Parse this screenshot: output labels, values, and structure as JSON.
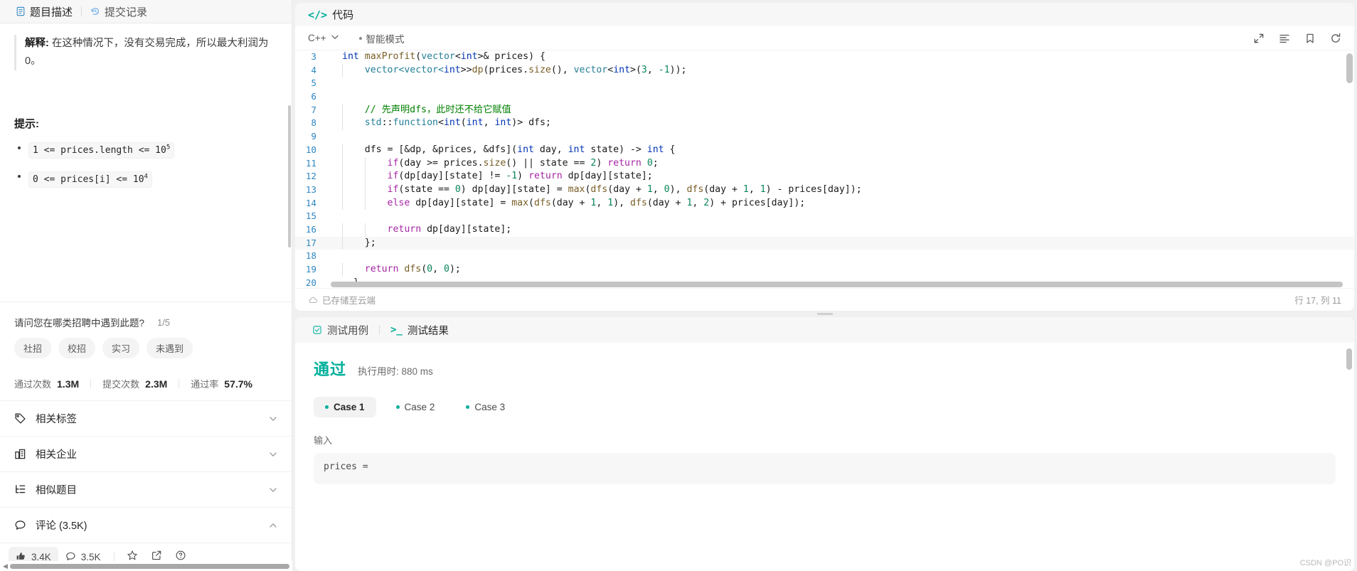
{
  "left": {
    "tabs": [
      {
        "label": "题目描述",
        "icon": "document-icon",
        "active": true
      },
      {
        "label": "提交记录",
        "icon": "history-icon",
        "active": false
      }
    ],
    "description": {
      "explanation_label": "解释:",
      "explanation_text": "在这种情况下，没有交易完成，所以最大利润为 0。"
    },
    "hints_title": "提示:",
    "hints": [
      {
        "expr": "1 <= prices.length <= 10",
        "sup": "5"
      },
      {
        "expr": "0 <= prices[i] <= 10",
        "sup": "4"
      }
    ],
    "poll": {
      "question": "请问您在哪类招聘中遇到此题?",
      "progress": "1/5",
      "options": [
        "社招",
        "校招",
        "实习",
        "未遇到"
      ]
    },
    "stats": [
      {
        "label": "通过次数",
        "value": "1.3M"
      },
      {
        "label": "提交次数",
        "value": "2.3M"
      },
      {
        "label": "通过率",
        "value": "57.7%"
      }
    ],
    "accordions": [
      {
        "label": "相关标签",
        "icon": "tag-icon",
        "expanded": false
      },
      {
        "label": "相关企业",
        "icon": "building-icon",
        "expanded": false
      },
      {
        "label": "相似题目",
        "icon": "list-tree-icon",
        "expanded": false
      },
      {
        "label": "评论 (3.5K)",
        "icon": "comment-icon",
        "expanded": true
      }
    ],
    "footer": {
      "like": {
        "icon": "thumbs-up-icon",
        "count": "3.4K"
      },
      "comment": {
        "icon": "comment-icon",
        "count": "3.5K"
      },
      "star": {
        "icon": "star-icon"
      },
      "share": {
        "icon": "share-external-icon"
      },
      "help": {
        "icon": "question-circle-icon"
      }
    }
  },
  "editor": {
    "panel_title": "代码",
    "panel_icon": "code-brackets-icon",
    "language": "C++",
    "mode": "智能模式",
    "toolbar_icons": [
      "expand-icon",
      "format-icon",
      "bookmark-icon",
      "reset-icon"
    ],
    "status_left": "已存储至云端",
    "status_left_icon": "cloud-icon",
    "status_right": "行 17, 列 11",
    "lines": [
      {
        "n": "3",
        "indent": 0,
        "hl": false,
        "tokens": [
          {
            "t": "int ",
            "c": "t-type"
          },
          {
            "t": "maxProfit",
            "c": "t-fn"
          },
          {
            "t": "(",
            "c": "t-pl"
          },
          {
            "t": "vector",
            "c": "t-ns"
          },
          {
            "t": "<",
            "c": "t-pl"
          },
          {
            "t": "int",
            "c": "t-type"
          },
          {
            "t": ">& prices) {",
            "c": "t-pl"
          }
        ]
      },
      {
        "n": "4",
        "indent": 1,
        "hl": false,
        "tokens": [
          {
            "t": "    vector<vector<",
            "c": "t-ns"
          },
          {
            "t": "int",
            "c": "t-type"
          },
          {
            "t": ">>",
            "c": "t-pl"
          },
          {
            "t": "dp",
            "c": "t-fn"
          },
          {
            "t": "(prices.",
            "c": "t-pl"
          },
          {
            "t": "size",
            "c": "t-fn"
          },
          {
            "t": "(), ",
            "c": "t-pl"
          },
          {
            "t": "vector",
            "c": "t-ns"
          },
          {
            "t": "<",
            "c": "t-pl"
          },
          {
            "t": "int",
            "c": "t-type"
          },
          {
            "t": ">(",
            "c": "t-pl"
          },
          {
            "t": "3",
            "c": "t-num"
          },
          {
            "t": ", ",
            "c": "t-pl"
          },
          {
            "t": "-1",
            "c": "t-num"
          },
          {
            "t": "));",
            "c": "t-pl"
          }
        ]
      },
      {
        "n": "5",
        "indent": 1,
        "hl": false,
        "tokens": []
      },
      {
        "n": "6",
        "indent": 1,
        "hl": false,
        "tokens": []
      },
      {
        "n": "7",
        "indent": 1,
        "hl": false,
        "tokens": [
          {
            "t": "    // 先声明dfs，此时还不给它赋值",
            "c": "t-com"
          }
        ]
      },
      {
        "n": "8",
        "indent": 1,
        "hl": false,
        "tokens": [
          {
            "t": "    std",
            "c": "t-ns"
          },
          {
            "t": "::",
            "c": "t-pl"
          },
          {
            "t": "function",
            "c": "t-ns"
          },
          {
            "t": "<",
            "c": "t-pl"
          },
          {
            "t": "int",
            "c": "t-type"
          },
          {
            "t": "(",
            "c": "t-pl"
          },
          {
            "t": "int",
            "c": "t-type"
          },
          {
            "t": ", ",
            "c": "t-pl"
          },
          {
            "t": "int",
            "c": "t-type"
          },
          {
            "t": ")> dfs;",
            "c": "t-pl"
          }
        ]
      },
      {
        "n": "9",
        "indent": 1,
        "hl": false,
        "tokens": []
      },
      {
        "n": "10",
        "indent": 1,
        "hl": false,
        "tokens": [
          {
            "t": "    dfs = [&dp, &prices, &dfs](",
            "c": "t-pl"
          },
          {
            "t": "int",
            "c": "t-type"
          },
          {
            "t": " day, ",
            "c": "t-pl"
          },
          {
            "t": "int",
            "c": "t-type"
          },
          {
            "t": " state) -> ",
            "c": "t-pl"
          },
          {
            "t": "int",
            "c": "t-type"
          },
          {
            "t": " {",
            "c": "t-pl"
          }
        ]
      },
      {
        "n": "11",
        "indent": 2,
        "hl": false,
        "tokens": [
          {
            "t": "        ",
            "c": "t-pl"
          },
          {
            "t": "if",
            "c": "t-key"
          },
          {
            "t": "(day >= prices.",
            "c": "t-pl"
          },
          {
            "t": "size",
            "c": "t-fn"
          },
          {
            "t": "() || state == ",
            "c": "t-pl"
          },
          {
            "t": "2",
            "c": "t-num"
          },
          {
            "t": ") ",
            "c": "t-pl"
          },
          {
            "t": "return",
            "c": "t-key"
          },
          {
            "t": " ",
            "c": "t-pl"
          },
          {
            "t": "0",
            "c": "t-num"
          },
          {
            "t": ";",
            "c": "t-pl"
          }
        ]
      },
      {
        "n": "12",
        "indent": 2,
        "hl": false,
        "tokens": [
          {
            "t": "        ",
            "c": "t-pl"
          },
          {
            "t": "if",
            "c": "t-key"
          },
          {
            "t": "(dp[day][state] != ",
            "c": "t-pl"
          },
          {
            "t": "-1",
            "c": "t-num"
          },
          {
            "t": ") ",
            "c": "t-pl"
          },
          {
            "t": "return",
            "c": "t-key"
          },
          {
            "t": " dp[day][state];",
            "c": "t-pl"
          }
        ]
      },
      {
        "n": "13",
        "indent": 2,
        "hl": false,
        "tokens": [
          {
            "t": "        ",
            "c": "t-pl"
          },
          {
            "t": "if",
            "c": "t-key"
          },
          {
            "t": "(state == ",
            "c": "t-pl"
          },
          {
            "t": "0",
            "c": "t-num"
          },
          {
            "t": ") dp[day][state] = ",
            "c": "t-pl"
          },
          {
            "t": "max",
            "c": "t-fn"
          },
          {
            "t": "(",
            "c": "t-pl"
          },
          {
            "t": "dfs",
            "c": "t-fn"
          },
          {
            "t": "(day + ",
            "c": "t-pl"
          },
          {
            "t": "1",
            "c": "t-num"
          },
          {
            "t": ", ",
            "c": "t-pl"
          },
          {
            "t": "0",
            "c": "t-num"
          },
          {
            "t": "), ",
            "c": "t-pl"
          },
          {
            "t": "dfs",
            "c": "t-fn"
          },
          {
            "t": "(day + ",
            "c": "t-pl"
          },
          {
            "t": "1",
            "c": "t-num"
          },
          {
            "t": ", ",
            "c": "t-pl"
          },
          {
            "t": "1",
            "c": "t-num"
          },
          {
            "t": ") - prices[day]);",
            "c": "t-pl"
          }
        ]
      },
      {
        "n": "14",
        "indent": 2,
        "hl": false,
        "tokens": [
          {
            "t": "        ",
            "c": "t-pl"
          },
          {
            "t": "else",
            "c": "t-key"
          },
          {
            "t": " dp[day][state] = ",
            "c": "t-pl"
          },
          {
            "t": "max",
            "c": "t-fn"
          },
          {
            "t": "(",
            "c": "t-pl"
          },
          {
            "t": "dfs",
            "c": "t-fn"
          },
          {
            "t": "(day + ",
            "c": "t-pl"
          },
          {
            "t": "1",
            "c": "t-num"
          },
          {
            "t": ", ",
            "c": "t-pl"
          },
          {
            "t": "1",
            "c": "t-num"
          },
          {
            "t": "), ",
            "c": "t-pl"
          },
          {
            "t": "dfs",
            "c": "t-fn"
          },
          {
            "t": "(day + ",
            "c": "t-pl"
          },
          {
            "t": "1",
            "c": "t-num"
          },
          {
            "t": ", ",
            "c": "t-pl"
          },
          {
            "t": "2",
            "c": "t-num"
          },
          {
            "t": ") + prices[day]);",
            "c": "t-pl"
          }
        ]
      },
      {
        "n": "15",
        "indent": 2,
        "hl": false,
        "tokens": []
      },
      {
        "n": "16",
        "indent": 2,
        "hl": false,
        "tokens": [
          {
            "t": "        ",
            "c": "t-pl"
          },
          {
            "t": "return",
            "c": "t-key"
          },
          {
            "t": " dp[day][state];",
            "c": "t-pl"
          }
        ]
      },
      {
        "n": "17",
        "indent": 1,
        "hl": true,
        "tokens": [
          {
            "t": "    };",
            "c": "t-pl"
          }
        ]
      },
      {
        "n": "18",
        "indent": 1,
        "hl": false,
        "tokens": []
      },
      {
        "n": "19",
        "indent": 1,
        "hl": false,
        "tokens": [
          {
            "t": "    ",
            "c": "t-pl"
          },
          {
            "t": "return",
            "c": "t-key"
          },
          {
            "t": " ",
            "c": "t-pl"
          },
          {
            "t": "dfs",
            "c": "t-fn"
          },
          {
            "t": "(",
            "c": "t-pl"
          },
          {
            "t": "0",
            "c": "t-num"
          },
          {
            "t": ", ",
            "c": "t-pl"
          },
          {
            "t": "0",
            "c": "t-num"
          },
          {
            "t": ");",
            "c": "t-pl"
          }
        ]
      },
      {
        "n": "20",
        "indent": 0,
        "hl": false,
        "tokens": [
          {
            "t": "  }",
            "c": "t-pl"
          }
        ]
      }
    ]
  },
  "results": {
    "tabs": [
      {
        "label": "测试用例",
        "icon": "checkbox-icon",
        "active": false
      },
      {
        "label": "测试结果",
        "icon": "terminal-icon",
        "active": true
      }
    ],
    "verdict": "通过",
    "runtime": "执行用时: 880 ms",
    "cases": [
      {
        "label": "Case 1",
        "active": true
      },
      {
        "label": "Case 2",
        "active": false
      },
      {
        "label": "Case 3",
        "active": false
      }
    ],
    "input_label": "输入",
    "input_value": "prices ="
  },
  "watermark": "CSDN @PO识",
  "colors": {
    "accent": "#00af9b",
    "link": "#2e86c1",
    "muted": "#8c8c8c"
  }
}
